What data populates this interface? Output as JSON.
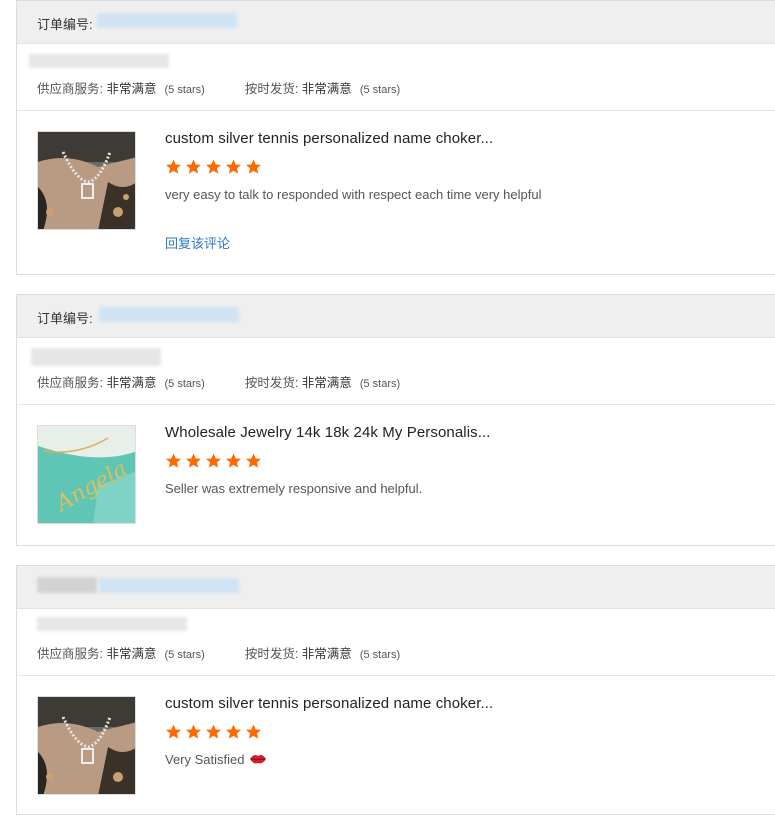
{
  "order_label": "订单编号:",
  "ratings": {
    "supplier_service_label": "供应商服务:",
    "supplier_service_value": "非常满意",
    "supplier_service_stars": "(5 stars)",
    "ontime_label": "按时发货:",
    "ontime_value": "非常满意",
    "ontime_stars": "(5 stars)"
  },
  "reviews": [
    {
      "product_title": "custom silver tennis personalized name choker...",
      "rating": 5,
      "comment": "very easy to talk to responded with respect each time very helpful",
      "reply_label": "回复该评论"
    },
    {
      "product_title": "Wholesale Jewelry 14k 18k 24k My Personalis...",
      "rating": 5,
      "comment": "Seller was extremely responsive and helpful.",
      "image_text": "Angela"
    },
    {
      "product_title": "custom silver tennis personalized name choker...",
      "rating": 5,
      "comment": "Very Satisfied"
    }
  ],
  "colors": {
    "star": "#ff6a00",
    "link": "#2a78c4",
    "header_bg": "#efefef"
  }
}
